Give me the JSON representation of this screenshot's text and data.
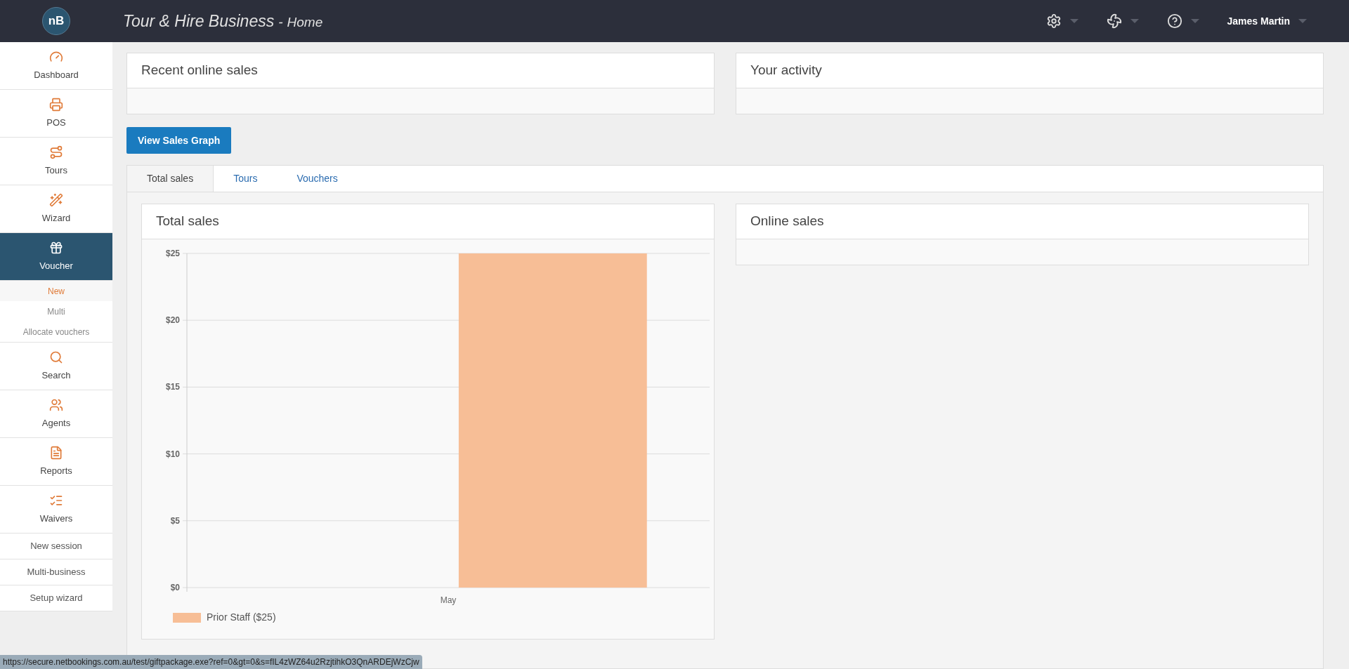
{
  "header": {
    "logo": "nB",
    "title": "Tour & Hire Business",
    "separator": "-",
    "subtitle": "Home",
    "user": "James Martin"
  },
  "sidebar": {
    "items": [
      {
        "label": "Dashboard",
        "selected": false
      },
      {
        "label": "POS",
        "selected": false
      },
      {
        "label": "Tours",
        "selected": false
      },
      {
        "label": "Wizard",
        "selected": false
      },
      {
        "label": "Voucher",
        "selected": true,
        "children": [
          {
            "label": "New",
            "selected": true
          },
          {
            "label": "Multi",
            "selected": false
          },
          {
            "label": "Allocate vouchers",
            "selected": false
          }
        ]
      },
      {
        "label": "Search",
        "selected": false
      },
      {
        "label": "Agents",
        "selected": false
      },
      {
        "label": "Reports",
        "selected": false
      },
      {
        "label": "Waivers",
        "selected": false
      }
    ],
    "links": [
      "New session",
      "Multi-business",
      "Setup wizard"
    ]
  },
  "top_panels": [
    {
      "title": "Recent online sales"
    },
    {
      "title": "Your activity"
    }
  ],
  "view_button": "View Sales Graph",
  "tabs": [
    {
      "label": "Total sales",
      "selected": true
    },
    {
      "label": "Tours",
      "selected": false
    },
    {
      "label": "Vouchers",
      "selected": false
    }
  ],
  "total_sales": {
    "title": "Total sales",
    "chart_data": {
      "type": "bar",
      "categories": [
        "May"
      ],
      "series": [
        {
          "name": "Prior Staff ($25)",
          "color": "#f7be96",
          "values": [
            25
          ]
        }
      ],
      "grid": true,
      "ylim": [
        0,
        25
      ],
      "yticks": [
        {
          "value": 0,
          "label": "$0"
        },
        {
          "value": 5,
          "label": "$5"
        },
        {
          "value": 10,
          "label": "$10"
        },
        {
          "value": 15,
          "label": "$15"
        },
        {
          "value": 20,
          "label": "$20"
        },
        {
          "value": 25,
          "label": "$25"
        }
      ]
    }
  },
  "online_sales": {
    "title": "Online sales"
  },
  "status_bar": "https://secure.netbookings.com.au/test/giftpackage.exe?ref=0&gt=0&s=fIL4zWZ64u2RzjtihkO3QnARDEjWzCjw"
}
